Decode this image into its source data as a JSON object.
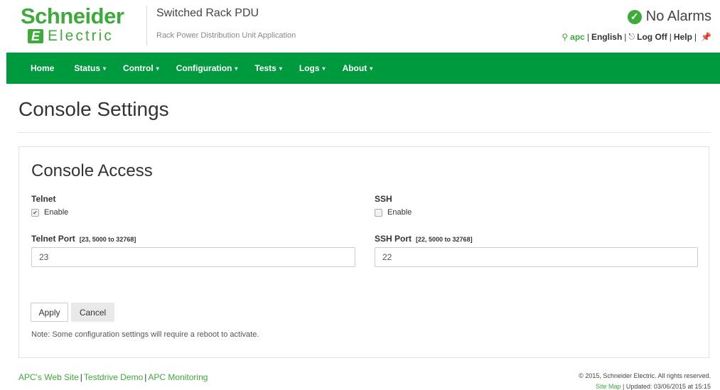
{
  "brand": {
    "line1": "Schneider",
    "line2": "Electric",
    "mark": "E"
  },
  "app": {
    "title": "Switched Rack PDU",
    "subtitle": "Rack Power Distribution Unit Application"
  },
  "status": {
    "alarms": "No Alarms",
    "icon": "check-circle-icon",
    "color": "#3dab3a"
  },
  "user_links": {
    "user": "apc",
    "language": "English",
    "logoff": "Log Off",
    "help": "Help"
  },
  "nav": {
    "items": [
      {
        "label": "Home",
        "caret": ""
      },
      {
        "label": "Status",
        "caret": "▾"
      },
      {
        "label": "Control",
        "caret": "▾"
      },
      {
        "label": "Configuration",
        "caret": "▾"
      },
      {
        "label": "Tests",
        "caret": "▾"
      },
      {
        "label": "Logs",
        "caret": "▾"
      },
      {
        "label": "About",
        "caret": "▾"
      }
    ],
    "color": "#009a3e"
  },
  "page": {
    "title": "Console Settings"
  },
  "panel": {
    "title": "Console Access",
    "telnet": {
      "label": "Telnet",
      "enable_label": "Enable",
      "enabled": true
    },
    "ssh": {
      "label": "SSH",
      "enable_label": "Enable",
      "enabled": false
    },
    "telnet_port": {
      "label": "Telnet Port",
      "range": "[23, 5000 to 32768]",
      "value": "23"
    },
    "ssh_port": {
      "label": "SSH Port",
      "range": "[22, 5000 to 32768]",
      "value": "22"
    },
    "apply_label": "Apply",
    "cancel_label": "Cancel",
    "note": "Note: Some configuration settings will require a reboot to activate."
  },
  "footer": {
    "links": [
      "APC's Web Site",
      "Testdrive Demo",
      "APC Monitoring"
    ],
    "copyright": "© 2015, Schneider Electric. All rights reserved.",
    "sitemap": "Site Map",
    "updated": "Updated: 03/06/2015 at 15:15"
  }
}
